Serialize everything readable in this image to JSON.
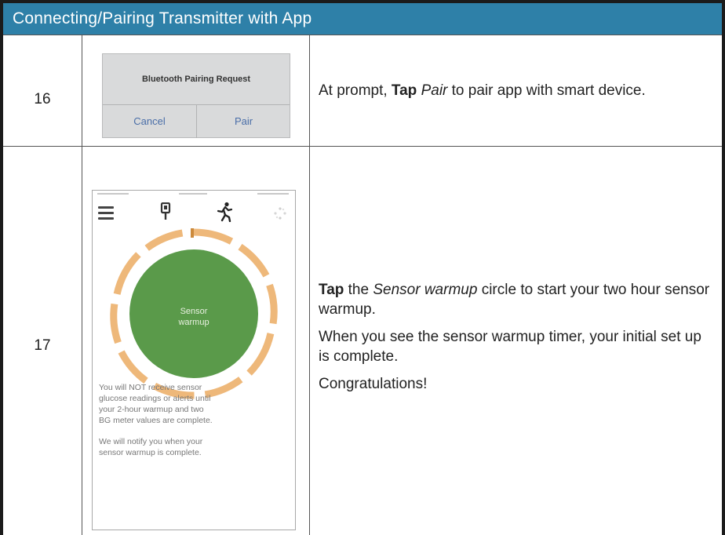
{
  "header": {
    "title": "Connecting/Pairing Transmitter with App"
  },
  "colors": {
    "header_bg": "#2e80a8",
    "circle_green": "#5a9a4a",
    "ring_orange": "#eeb87a"
  },
  "steps": [
    {
      "number": "16",
      "dialog": {
        "title": "Bluetooth Pairing Request",
        "cancel": "Cancel",
        "pair": "Pair"
      },
      "instruction": {
        "bold1": "At prompt, ",
        "tap": "Tap",
        "italic": "Pair",
        "rest": " to pair app with smart device."
      }
    },
    {
      "number": "17",
      "phone": {
        "icons": [
          "menu-icon",
          "transmitter-icon",
          "running-person-icon",
          "dots-icon"
        ],
        "circle_label_line1": "Sensor",
        "circle_label_line2": "warmup",
        "note1_lines": [
          "You will NOT receive sensor",
          "glucose readings or alerts until",
          "your 2-hour warmup and two",
          "BG meter values are complete."
        ],
        "note2_lines": [
          "We will notify you when your",
          "sensor warmup is complete."
        ]
      },
      "instruction": {
        "p1_tap": "Tap",
        "p1_space": " the ",
        "p1_italic": "Sensor warmup",
        "p1_rest": " circle to start your two hour sensor warmup.",
        "p2": "When you see the sensor warmup timer, your initial set up is complete.",
        "p3": "Congratulations!"
      }
    }
  ]
}
